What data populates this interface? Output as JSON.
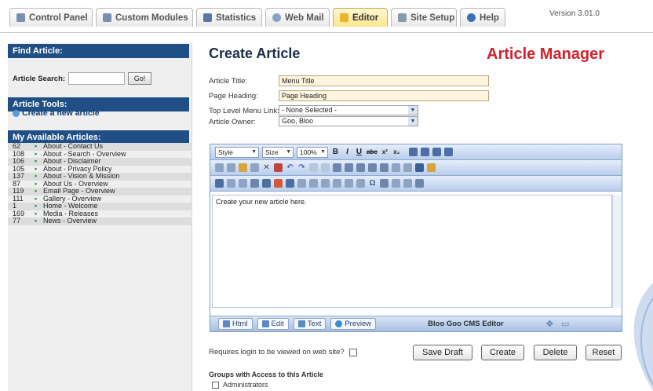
{
  "tabs": [
    {
      "label": "Control Panel",
      "icon": "home-icon"
    },
    {
      "label": "Custom Modules",
      "icon": "tools-icon"
    },
    {
      "label": "Statistics",
      "icon": "chart-icon"
    },
    {
      "label": "Web Mail",
      "icon": "mail-icon"
    },
    {
      "label": "Editor",
      "icon": "folder-icon"
    },
    {
      "label": "Site Setup",
      "icon": "setup-icon"
    },
    {
      "label": "Help",
      "icon": "help-icon"
    }
  ],
  "version": "Version 3.01.0",
  "sidebar": {
    "find_title": "Find Article:",
    "search_label": "Article Search:",
    "go_label": "Go!",
    "tools_title": "Article Tools:",
    "create_link": "Create a new article",
    "available_title": "My Available Articles:",
    "articles": [
      {
        "id": "62",
        "title": "About - Contact Us"
      },
      {
        "id": "108",
        "title": "About - Search - Overview"
      },
      {
        "id": "106",
        "title": "About - Disclaimer"
      },
      {
        "id": "105",
        "title": "About - Privacy Policy"
      },
      {
        "id": "137",
        "title": "About - Vision & Mission"
      },
      {
        "id": "87",
        "title": "About Us - Overview"
      },
      {
        "id": "119",
        "title": "Email Page - Overview"
      },
      {
        "id": "111",
        "title": "Gallery - Overview"
      },
      {
        "id": "1",
        "title": "Home - Welcome"
      },
      {
        "id": "169",
        "title": "Media - Releases"
      },
      {
        "id": "77",
        "title": "News - Overview"
      }
    ]
  },
  "main": {
    "heading": "Create Article",
    "brand": "Article Manager",
    "article_title_label": "Article Title:",
    "article_title_value": "Menu Title",
    "page_heading_label": "Page Heading:",
    "page_heading_value": "Page Heading",
    "menu_link_label": "Top Level Menu Link:",
    "menu_link_value": "- None Selected -",
    "owner_label": "Article Owner:",
    "owner_value": "Goo, Bloo"
  },
  "editor": {
    "style_label": "Style",
    "size_label": "Size",
    "zoom_label": "100%",
    "content": "Create your new article here.",
    "footer_tabs": [
      {
        "label": "Html"
      },
      {
        "label": "Edit"
      },
      {
        "label": "Text"
      },
      {
        "label": "Preview"
      }
    ],
    "footer_label": "Bloo Goo CMS Editor"
  },
  "actions": {
    "requires_login_label": "Requires login to be viewed on web site?",
    "save_draft": "Save Draft",
    "create": "Create",
    "delete": "Delete",
    "reset": "Reset"
  },
  "groups": {
    "title": "Groups with Access to this Article",
    "items": [
      "Administrators"
    ]
  },
  "colors": {
    "accent": "#1f4f85",
    "brand": "#d2212b"
  }
}
